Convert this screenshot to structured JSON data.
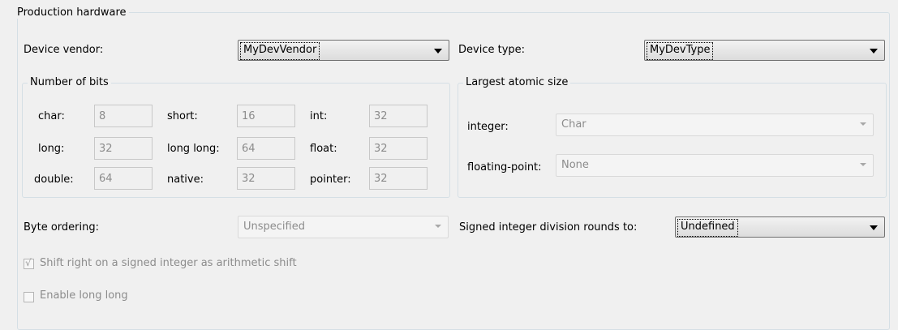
{
  "group_title": "Production hardware",
  "device_vendor": {
    "label": "Device vendor:",
    "value": "MyDevVendor"
  },
  "device_type": {
    "label": "Device type:",
    "value": "MyDevType"
  },
  "bits": {
    "title": "Number of bits",
    "fields": [
      {
        "label": "char:",
        "value": "8"
      },
      {
        "label": "short:",
        "value": "16"
      },
      {
        "label": "int:",
        "value": "32"
      },
      {
        "label": "long:",
        "value": "32"
      },
      {
        "label": "long long:",
        "value": "64"
      },
      {
        "label": "float:",
        "value": "32"
      },
      {
        "label": "double:",
        "value": "64"
      },
      {
        "label": "native:",
        "value": "32"
      },
      {
        "label": "pointer:",
        "value": "32"
      }
    ]
  },
  "atomic": {
    "title": "Largest atomic size",
    "integer": {
      "label": "integer:",
      "value": "Char"
    },
    "floating_point": {
      "label": "floating-point:",
      "value": "None"
    }
  },
  "byte_ordering": {
    "label": "Byte ordering:",
    "value": "Unspecified"
  },
  "signed_division": {
    "label": "Signed integer division rounds to:",
    "value": "Undefined"
  },
  "shift_right": {
    "label": "Shift right on a signed integer as arithmetic shift",
    "checked": true,
    "check_glyph": "√"
  },
  "enable_long_long": {
    "label": "Enable long long",
    "checked": false
  }
}
